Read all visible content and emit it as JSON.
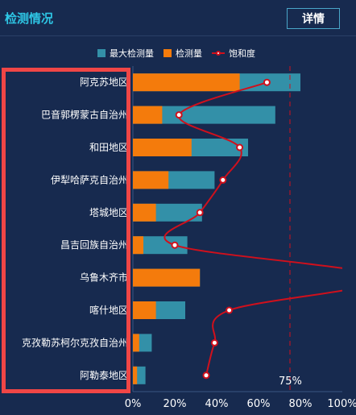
{
  "header": {
    "title": "检测情况",
    "detail_label": "详情"
  },
  "colors": {
    "background": "#172a4f",
    "max_bar": "#3390a8",
    "detect_bar": "#f47b0c",
    "saturation_line": "#d0101c",
    "threshold_line": "#d0101c",
    "title": "#2ec7e6",
    "highlight_frame": "#f04646"
  },
  "chart_data": {
    "type": "bar",
    "orientation": "horizontal",
    "categories": [
      "阿克苏地区",
      "巴音郭楞蒙古自治州",
      "和田地区",
      "伊犁哈萨克自治州",
      "塔城地区",
      "昌吉回族自治州",
      "乌鲁木齐市",
      "喀什地区",
      "克孜勒苏柯尔克孜自治州",
      "阿勒泰地区"
    ],
    "series": [
      {
        "name": "最大检测量",
        "type": "bar",
        "values": [
          80,
          68,
          55,
          39,
          33,
          26,
          32,
          25,
          9,
          6
        ]
      },
      {
        "name": "检测量",
        "type": "bar",
        "values": [
          51,
          14,
          28,
          17,
          11,
          5,
          32,
          11,
          3,
          2
        ]
      },
      {
        "name": "饱和度",
        "type": "line",
        "values": [
          64,
          22,
          51,
          43,
          32,
          20,
          120,
          46,
          39,
          35
        ]
      }
    ],
    "x_axis": {
      "min": 0,
      "max": 100,
      "ticks": [
        "0%",
        "20%",
        "40%",
        "60%",
        "80%",
        "100%"
      ]
    },
    "threshold": {
      "value": 75,
      "label": "75%"
    },
    "legend_position": "top-center",
    "grid": false
  }
}
